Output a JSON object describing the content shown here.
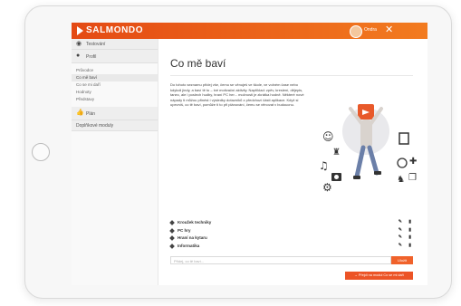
{
  "brand": {
    "name": "SALMONDO",
    "accent": "#ec5a22"
  },
  "user": {
    "name": "Ondra"
  },
  "sidebar": {
    "sections": [
      {
        "label": "Testování",
        "icon": "gauge-icon"
      },
      {
        "label": "Profil",
        "icon": "person-icon"
      }
    ],
    "profile_links": [
      "Průvodce",
      "Co mě baví",
      "Co se mi daří",
      "Hodnoty",
      "Představy"
    ],
    "active_link": "Co mě baví",
    "plan": {
      "label": "Plán",
      "icon": "thumbs-up-icon"
    },
    "extra": {
      "label": "Doplňkové moduly"
    }
  },
  "main": {
    "title": "Co mě baví",
    "intro": "Do tohoto seznamu přidej vše, čemu se věnuješ ve škole, ve volném čase nebo kdykoli jindy, a baví tě to – tvé motivační aktivity. Například: zpěv, kreslení, dějepis, tanec, ale i poslech hudby, hraní PC her... možnosti je zkrátka hodně. Některé nové nápady ti můžou přinést i výsledky dotazníků z předchozí části aplikace. Když si upevníš, co tě baví, pomůže ti to při plánování, čemu se věnovat v budoucnu.",
    "interests": [
      "Kroužek techniky",
      "PC hry",
      "Hraní na kytaru",
      "Informatika"
    ],
    "add_placeholder": "Přidej, co tě baví...",
    "add_label": "Uložit",
    "next_label": "→ Přejdi na modul Co se mi daří"
  }
}
